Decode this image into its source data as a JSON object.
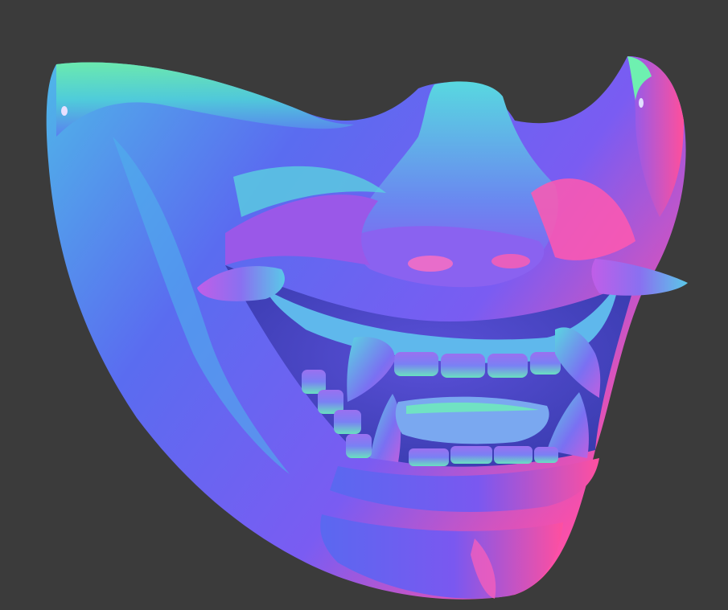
{
  "viewport": {
    "background": "#3b3b3b",
    "subject": "oni-half-mask-icon",
    "shading": "normal-map"
  },
  "palette": {
    "blue": "#4f63f2",
    "violet": "#8a5cf2",
    "magenta": "#ff4fb0",
    "cyan": "#4fd9d0",
    "green": "#6ef0a0"
  }
}
